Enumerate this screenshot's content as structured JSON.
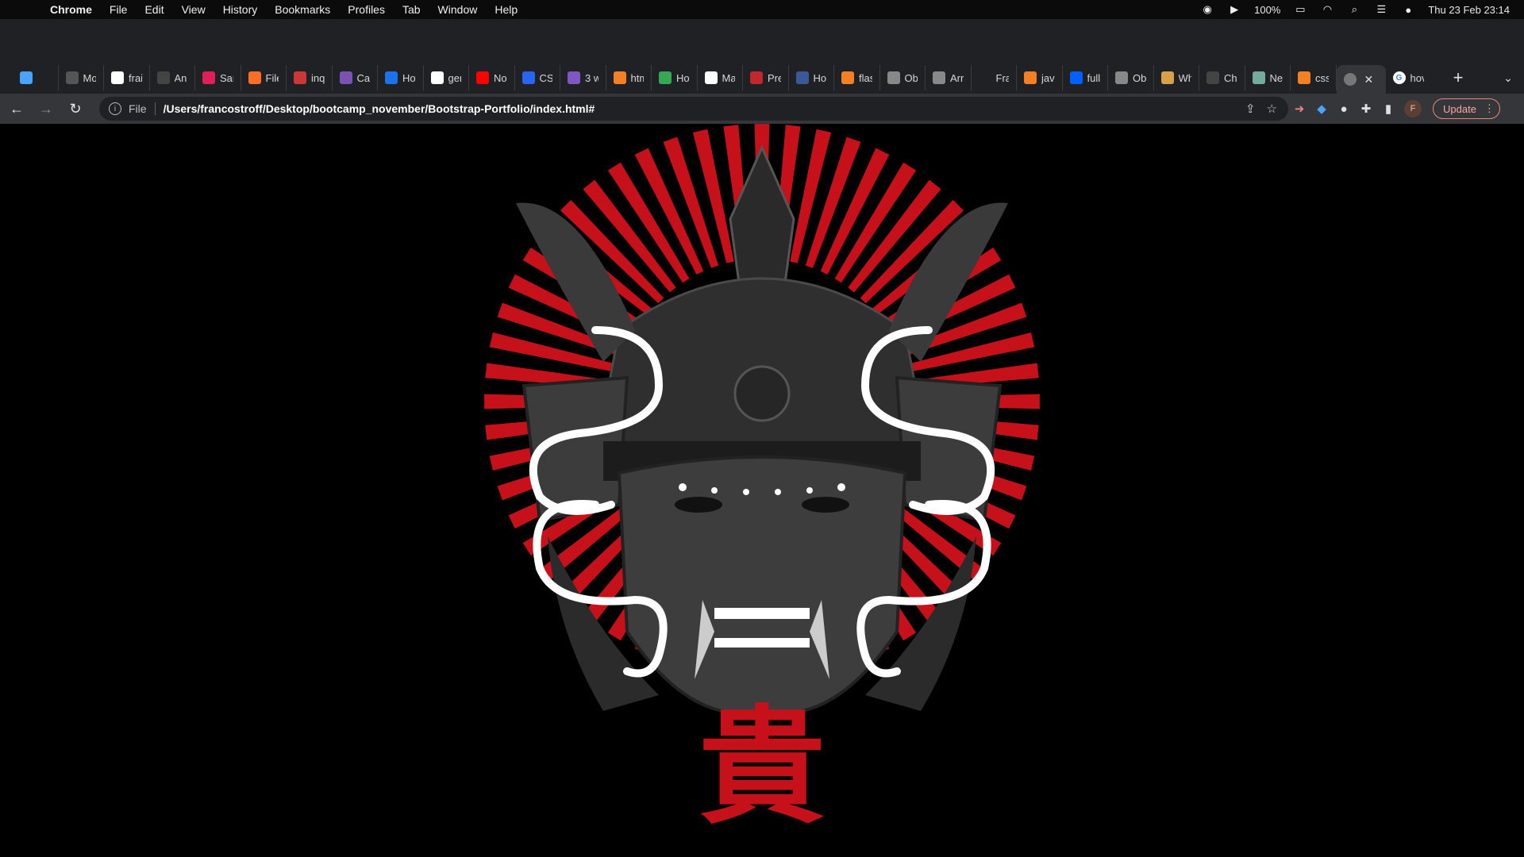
{
  "menubar": {
    "apple": "",
    "items": [
      "Chrome",
      "File",
      "Edit",
      "View",
      "History",
      "Bookmarks",
      "Profiles",
      "Tab",
      "Window",
      "Help"
    ],
    "battery": "100%",
    "datetime": "Thu 23 Feb  23:14"
  },
  "tabs": [
    {
      "label": "",
      "icon": "gem-icon",
      "color": "#4aa3ff"
    },
    {
      "label": "Mo",
      "icon": "wix-icon",
      "color": "#555555"
    },
    {
      "label": "frai",
      "icon": "github-icon",
      "color": "#ffffff"
    },
    {
      "label": "An",
      "icon": "openai-icon",
      "color": "#444444"
    },
    {
      "label": "Sar",
      "icon": "slack-icon",
      "color": "#e01e5a"
    },
    {
      "label": "File",
      "icon": "gitlab-icon",
      "color": "#fc6d26"
    },
    {
      "label": "inq",
      "icon": "npm-icon",
      "color": "#cb3837"
    },
    {
      "label": "Car",
      "icon": "bootstrap-icon",
      "color": "#7952b3"
    },
    {
      "label": "Hov",
      "icon": "refresh-icon",
      "color": "#1a73e8"
    },
    {
      "label": "ger",
      "icon": "google-icon",
      "color": "#ffffff"
    },
    {
      "label": "Noc",
      "icon": "youtube-icon",
      "color": "#ff0000"
    },
    {
      "label": "CSS",
      "icon": "css-icon",
      "color": "#2965f1"
    },
    {
      "label": "3 w",
      "icon": "a-icon",
      "color": "#7e57c2"
    },
    {
      "label": "htm",
      "icon": "stackoverflow-icon",
      "color": "#f48024"
    },
    {
      "label": "Hov",
      "icon": "link-icon",
      "color": "#34a853"
    },
    {
      "label": "Ma",
      "icon": "github-icon",
      "color": "#ffffff"
    },
    {
      "label": "Pre",
      "icon": "pen-icon",
      "color": "#c1272d"
    },
    {
      "label": "Hov",
      "icon": "doc-icon",
      "color": "#3b5998"
    },
    {
      "label": "flas",
      "icon": "stackoverflow-icon",
      "color": "#f48024"
    },
    {
      "label": "Obj",
      "icon": "mdn-icon",
      "color": "#888888"
    },
    {
      "label": "Arr",
      "icon": "mdn-icon",
      "color": "#888888"
    },
    {
      "label": "Fra",
      "icon": "blank-icon",
      "color": "#202124"
    },
    {
      "label": "java",
      "icon": "stackoverflow-icon",
      "color": "#f48024"
    },
    {
      "label": "full",
      "icon": "dropbox-icon",
      "color": "#0061fe"
    },
    {
      "label": "Obj",
      "icon": "mdn-icon",
      "color": "#888888"
    },
    {
      "label": "Wh",
      "icon": "glasses-icon",
      "color": "#d7a14a"
    },
    {
      "label": "Cha",
      "icon": "openai-icon",
      "color": "#444444"
    },
    {
      "label": "Ne",
      "icon": "chatgpt-icon",
      "color": "#74aa9c"
    },
    {
      "label": "css",
      "icon": "stackoverflow-icon",
      "color": "#f48024"
    }
  ],
  "active_tab": {
    "label": "",
    "icon": "globe-icon",
    "close": "✕"
  },
  "last_tab": {
    "label": "hov",
    "icon": "google-icon"
  },
  "toolbar": {
    "scheme": "File",
    "url": "/Users/francostroff/Desktop/bootcamp_november/Bootstrap-Portfolio/index.html#",
    "profile_initial": "F",
    "update_label": "Update"
  },
  "page": {
    "kanji": "貴",
    "colors": {
      "red": "#c6111b",
      "background": "#000000",
      "mask": "#3a3a3a"
    }
  }
}
